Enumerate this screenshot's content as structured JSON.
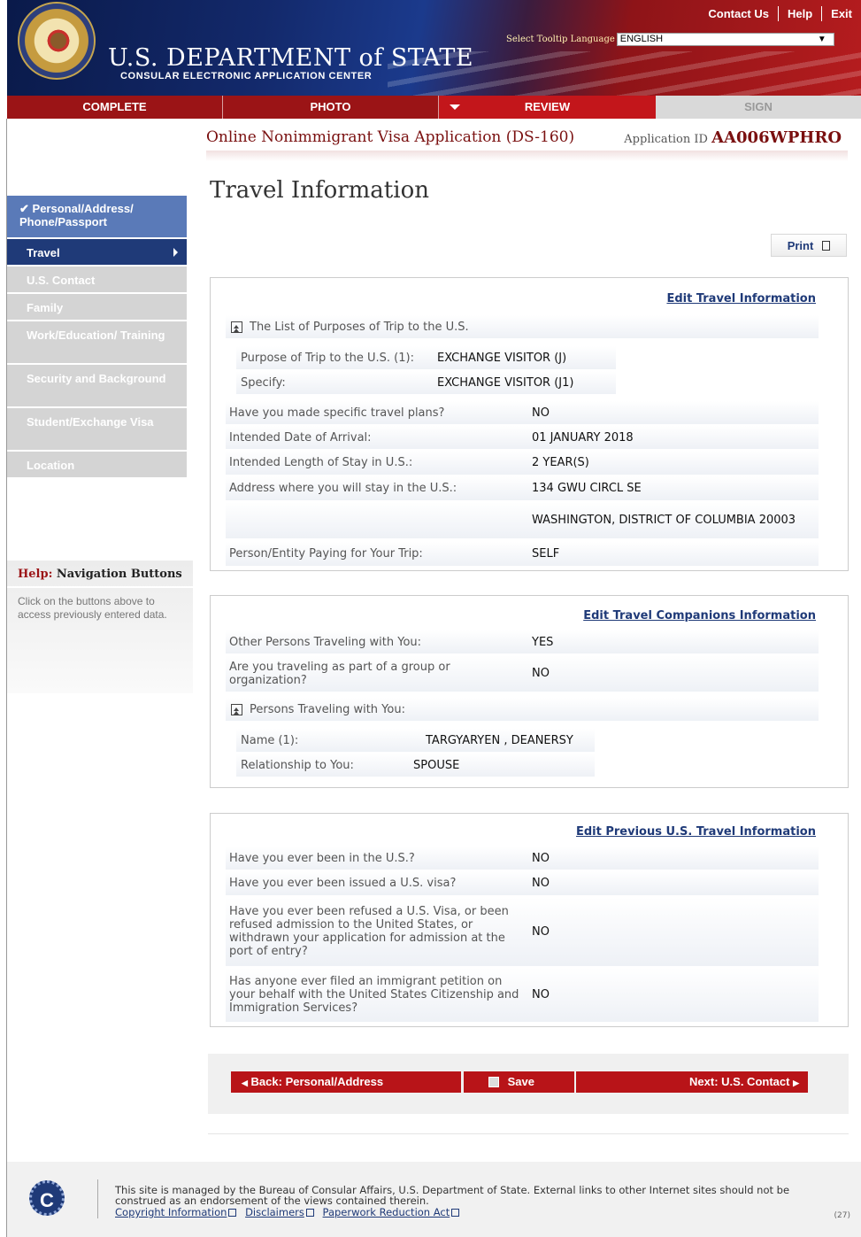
{
  "header": {
    "title_main": "U.S. DEPARTMENT of STATE",
    "title_sub": "CONSULAR ELECTRONIC APPLICATION CENTER",
    "links": [
      "Contact Us",
      "Help",
      "Exit"
    ],
    "language_label": "Select Tooltip Language",
    "language_value": "ENGLISH"
  },
  "tabs": [
    "COMPLETE",
    "PHOTO",
    "REVIEW",
    "SIGN"
  ],
  "app": {
    "title": "Online Nonimmigrant Visa Application (DS-160)",
    "id_label": "Application ID",
    "id_value": "AA006WPHRO"
  },
  "sidebar": {
    "items": [
      {
        "label": "Personal/Address/ Phone/Passport",
        "check": "✔"
      },
      {
        "label": "Travel"
      },
      {
        "label": "U.S. Contact"
      },
      {
        "label": "Family"
      },
      {
        "label": "Work/Education/ Training"
      },
      {
        "label": "Security and Background"
      },
      {
        "label": "Student/Exchange Visa"
      },
      {
        "label": "Location"
      }
    ],
    "help_prefix": "Help:",
    "help_title": "Navigation Buttons",
    "help_text": "Click on the buttons above to access previously entered data."
  },
  "page_title": "Travel Information",
  "print_label": "Print",
  "travel": {
    "edit_link": "Edit Travel Information",
    "purposes_header": "The List of Purposes of Trip to the U.S.",
    "purpose_q": "Purpose of Trip to the U.S. (1):",
    "purpose_a": "EXCHANGE VISITOR (J)",
    "specify_q": "Specify:",
    "specify_a": "EXCHANGE VISITOR (J1)",
    "rows": [
      {
        "q": "Have you made specific travel plans?",
        "a": "NO"
      },
      {
        "q": "Intended Date of Arrival:",
        "a": "01 JANUARY 2018"
      },
      {
        "q": "Intended Length of Stay in U.S.:",
        "a": "2 YEAR(S)"
      },
      {
        "q": "Address where you will stay in the U.S.:",
        "a": "134 GWU CIRCL SE"
      },
      {
        "q": "",
        "a": "WASHINGTON, DISTRICT OF COLUMBIA 20003"
      },
      {
        "q": "Person/Entity Paying for Your Trip:",
        "a": "SELF"
      }
    ]
  },
  "companions": {
    "edit_link": "Edit Travel Companions Information",
    "rows": [
      {
        "q": "Other Persons Traveling with You:",
        "a": "YES"
      },
      {
        "q": "Are you traveling as part of a group or organization?",
        "a": "NO"
      }
    ],
    "persons_header": "Persons Traveling with You:",
    "name_q": "Name (1):",
    "name_a": "TARGYARYEN , DEANERSY",
    "rel_q": "Relationship to You:",
    "rel_a": "SPOUSE"
  },
  "previous": {
    "edit_link": "Edit Previous U.S. Travel Information",
    "rows": [
      {
        "q": "Have you ever been in the U.S.?",
        "a": "NO"
      },
      {
        "q": "Have you ever been issued a U.S. visa?",
        "a": "NO"
      },
      {
        "q": "Have you ever been refused a U.S. Visa, or been refused admission to the United States, or withdrawn your application for admission at the port of entry?",
        "a": "NO"
      },
      {
        "q": "Has anyone ever filed an immigrant petition on your behalf with the United States Citizenship and Immigration Services?",
        "a": "NO"
      }
    ]
  },
  "nav": {
    "back": "Back: Personal/Address",
    "save": "Save",
    "next": "Next: U.S. Contact"
  },
  "footer": {
    "logo": "C",
    "text": "This site is managed by the Bureau of Consular Affairs, U.S. Department of State. External links to other Internet sites should not be construed as an endorsement of the views contained therein.",
    "links": [
      "Copyright Information",
      "Disclaimers",
      "Paperwork Reduction Act"
    ],
    "page_num": "(27)"
  }
}
